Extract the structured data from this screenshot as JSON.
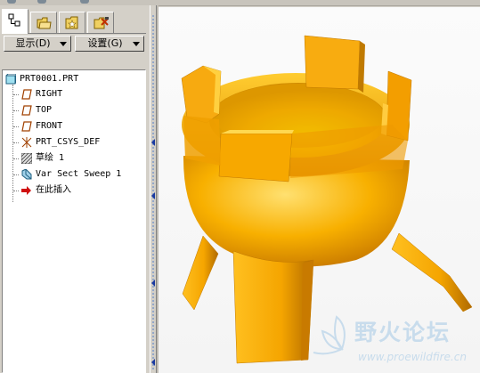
{
  "tabs": [
    {
      "name": "model-tree",
      "icon": "model-tree-icon",
      "active": true
    },
    {
      "name": "folder-browser",
      "icon": "folder-icon"
    },
    {
      "name": "favorites",
      "icon": "favorites-icon"
    },
    {
      "name": "connections",
      "icon": "connections-icon"
    }
  ],
  "toolbar": {
    "show_label": "显示(D)",
    "settings_label": "设置(G)"
  },
  "tree": {
    "root": {
      "label": "PRT0001.PRT",
      "icon": "part-icon"
    },
    "items": [
      {
        "label": "RIGHT",
        "icon": "datum-plane-icon"
      },
      {
        "label": "TOP",
        "icon": "datum-plane-icon"
      },
      {
        "label": "FRONT",
        "icon": "datum-plane-icon"
      },
      {
        "label": "PRT_CSYS_DEF",
        "icon": "coordinate-system-icon"
      },
      {
        "label": "草绘 1",
        "icon": "sketch-icon"
      },
      {
        "label": "Var Sect Sweep 1",
        "icon": "sweep-icon"
      },
      {
        "label": "在此插入",
        "icon": "insert-here-arrow-icon"
      }
    ]
  },
  "viewport": {
    "model": "var-sect-sweep-part",
    "model_color": "#f5a800",
    "background": "#f8f8f8"
  },
  "watermark": {
    "chinese": "野火论坛",
    "url": "www.proewildfire.cn",
    "color": "#c8dcec"
  }
}
